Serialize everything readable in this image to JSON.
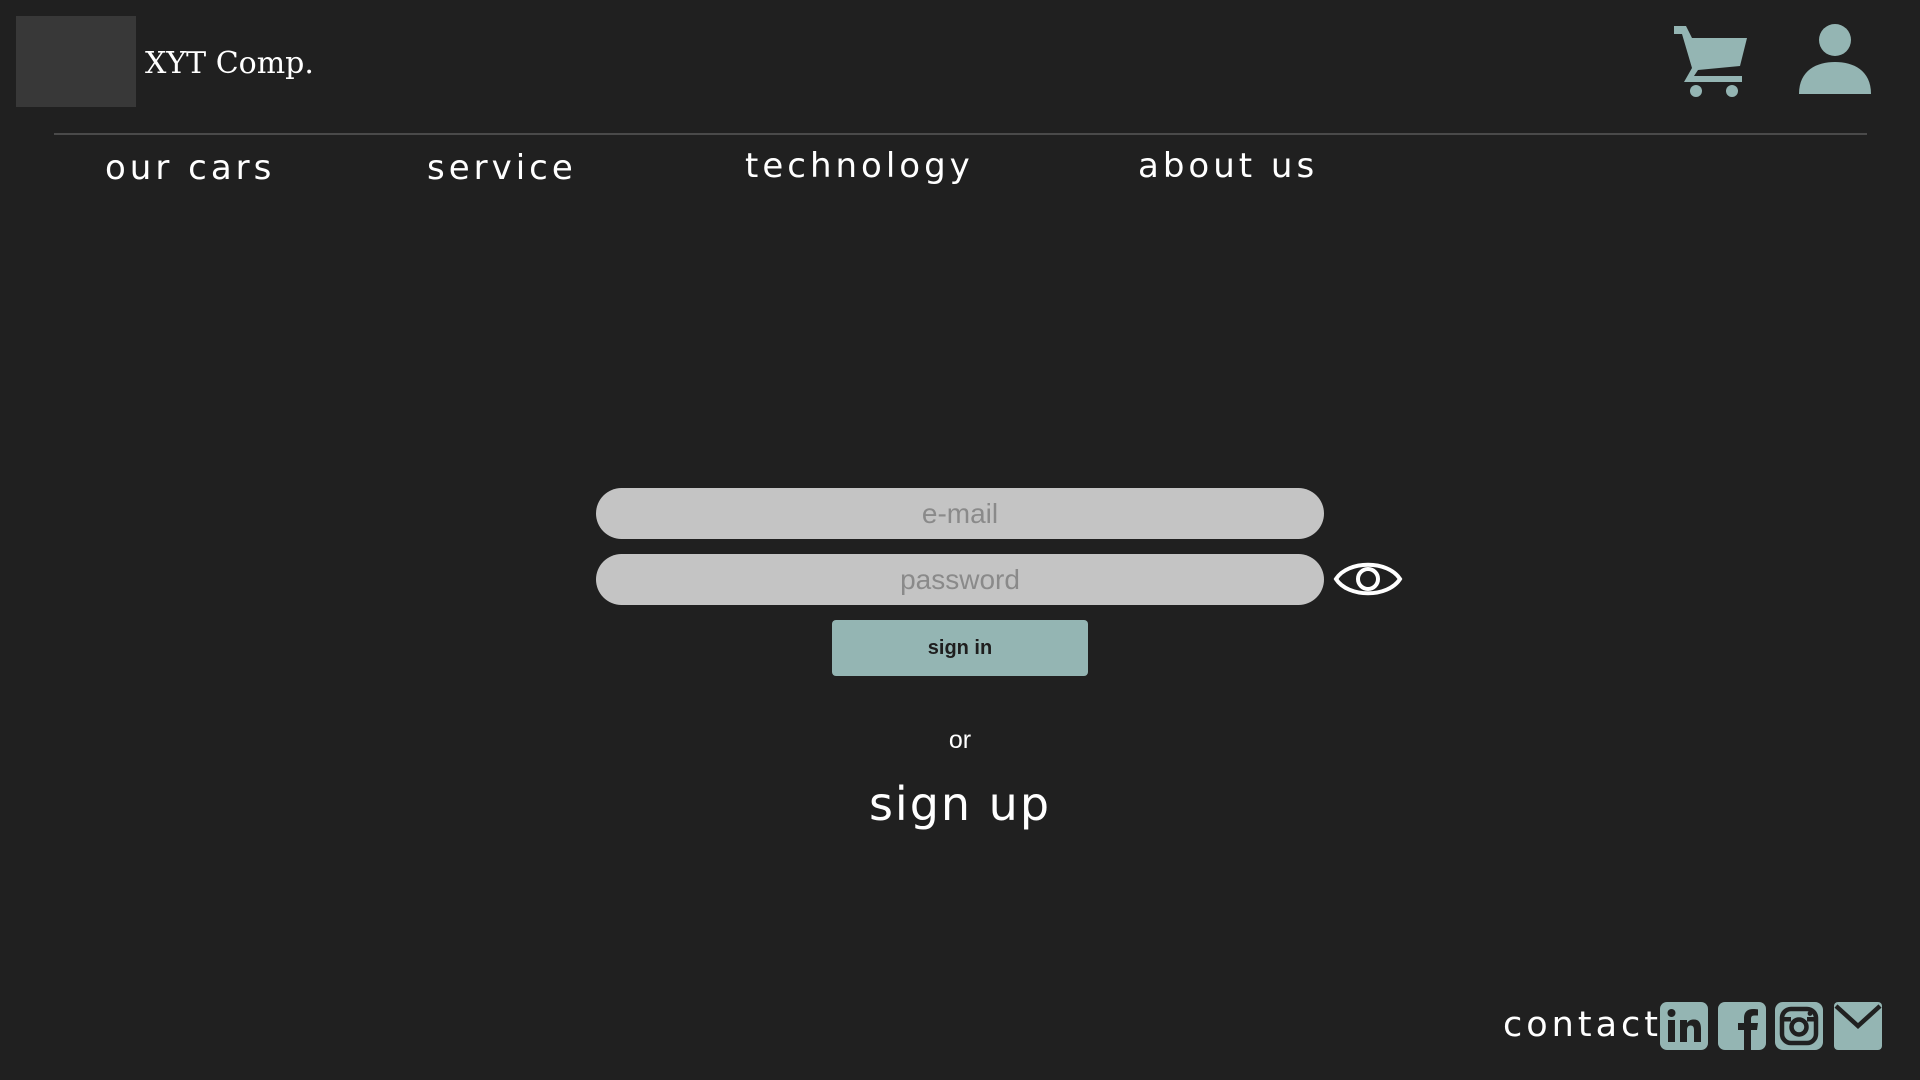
{
  "brand": {
    "name": "XYT Comp."
  },
  "header": {
    "cart_icon": "shopping-cart-icon",
    "account_icon": "user-icon",
    "icon_color": "#94b5b3"
  },
  "nav": {
    "items": [
      {
        "label": "our cars"
      },
      {
        "label": "service"
      },
      {
        "label": "technology"
      },
      {
        "label": "about us"
      }
    ]
  },
  "login": {
    "email": {
      "placeholder": "e-mail",
      "value": ""
    },
    "password": {
      "placeholder": "password",
      "value": ""
    },
    "show_password_icon": "eye-icon",
    "signin_label": "sign in",
    "or_text": "or",
    "signup_label": "sign up",
    "accent_color": "#94b5b3"
  },
  "footer": {
    "contact_label": "contact",
    "social_icons": [
      "linkedin-icon",
      "facebook-icon",
      "instagram-icon",
      "mail-icon"
    ]
  }
}
